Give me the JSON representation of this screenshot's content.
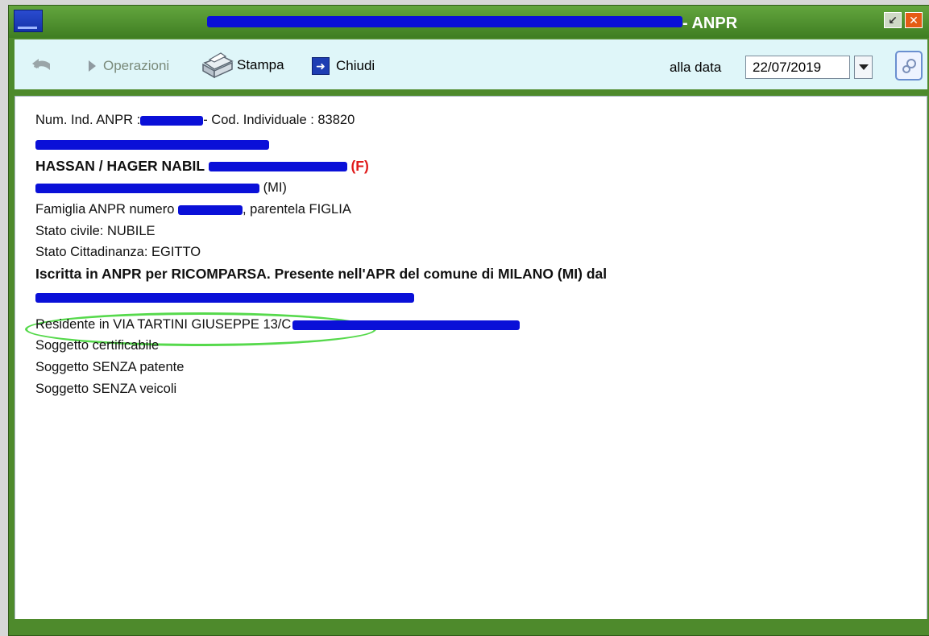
{
  "window": {
    "title_suffix": "- ANPR",
    "restore_glyph": "↙",
    "close_glyph": "✕"
  },
  "toolbar": {
    "operazioni_label": "Operazioni",
    "stampa_label": "Stampa",
    "chiudi_label": "Chiudi",
    "alla_data_label": "alla data",
    "date_value": "22/07/2019"
  },
  "icons": {
    "back": "back-arrow-icon",
    "operazioni": "play-triangle-icon",
    "stampa": "printer-icon",
    "chiudi": "exit-icon",
    "dropdown": "chevron-down-icon",
    "config": "gear-icon"
  },
  "content": {
    "line1_prefix": "Num. Ind. ANPR :",
    "line1_suffix": "- Cod. Individuale : 83820",
    "name_prefix": "HASSAN / HAGER NABIL",
    "sex_marker": "(F)",
    "birth_province": "(MI)",
    "family_prefix": "Famiglia ANPR numero",
    "family_suffix": ", parentela FIGLIA",
    "civil_status": "Stato civile: NUBILE",
    "citizenship": "Stato Cittadinanza: EGITTO",
    "registration": "Iscritta in ANPR per RICOMPARSA. Presente nell'APR del comune di MILANO (MI) dal",
    "residence": "Residente in VIA TARTINI GIUSEPPE 13/C",
    "certifiable": "Soggetto certificabile",
    "no_license": "Soggetto SENZA patente",
    "no_vehicles": "Soggetto SENZA veicoli"
  },
  "colors": {
    "frame": "#4e8a2c",
    "toolbar_bg": "#dff6f9",
    "redaction": "#0a10d8",
    "highlight": "#56d94c",
    "accent_red": "#e01a1a",
    "link": "#1c3bd0"
  }
}
